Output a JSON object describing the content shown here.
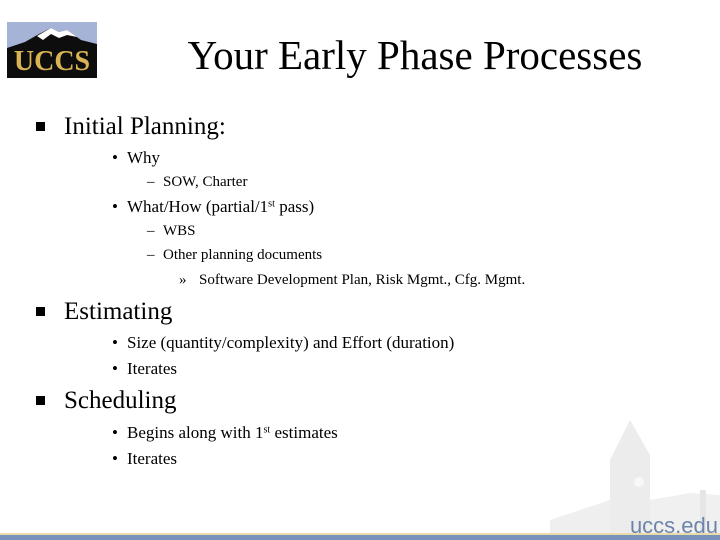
{
  "logo": {
    "text": "UCCS",
    "colors": {
      "background": "#0d0d0d",
      "sky": "#a5b3d6",
      "text": "#d8b452"
    }
  },
  "title": "Your Early Phase Processes",
  "sections": [
    {
      "label": "Initial Planning:",
      "items": [
        {
          "bullet": "•",
          "label": "Why",
          "children": [
            {
              "bullet": "–",
              "label": "SOW, Charter"
            }
          ]
        },
        {
          "bullet": "•",
          "label_before_sup": "What/How (partial/1",
          "sup": "st",
          "label_after_sup": " pass)",
          "children": [
            {
              "bullet": "–",
              "label": "WBS"
            },
            {
              "bullet": "–",
              "label": "Other planning documents",
              "children": [
                {
                  "bullet": "»",
                  "label": "Software Development Plan, Risk Mgmt., Cfg. Mgmt."
                }
              ]
            }
          ]
        }
      ]
    },
    {
      "label": "Estimating",
      "items": [
        {
          "bullet": "•",
          "label": "Size (quantity/complexity) and Effort (duration)"
        },
        {
          "bullet": "•",
          "label": "Iterates"
        }
      ]
    },
    {
      "label": "Scheduling",
      "items": [
        {
          "bullet": "•",
          "label_before_sup": "Begins along with 1",
          "sup": "st",
          "label_after_sup": " estimates"
        },
        {
          "bullet": "•",
          "label": "Iterates"
        }
      ]
    }
  ],
  "footer": {
    "url": "uccs.edu",
    "colors": {
      "line": "#e9dca8",
      "bar": "#7891ba",
      "url": "#6d84aa"
    }
  }
}
